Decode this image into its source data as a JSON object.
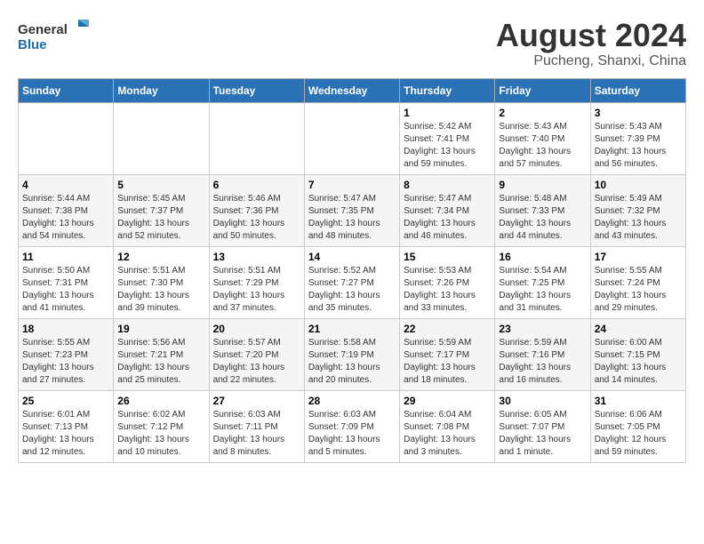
{
  "header": {
    "logo_general": "General",
    "logo_blue": "Blue",
    "month_title": "August 2024",
    "location": "Pucheng, Shanxi, China"
  },
  "days_of_week": [
    "Sunday",
    "Monday",
    "Tuesday",
    "Wednesday",
    "Thursday",
    "Friday",
    "Saturday"
  ],
  "weeks": [
    [
      {
        "day": "",
        "content": ""
      },
      {
        "day": "",
        "content": ""
      },
      {
        "day": "",
        "content": ""
      },
      {
        "day": "",
        "content": ""
      },
      {
        "day": "1",
        "content": "Sunrise: 5:42 AM\nSunset: 7:41 PM\nDaylight: 13 hours\nand 59 minutes."
      },
      {
        "day": "2",
        "content": "Sunrise: 5:43 AM\nSunset: 7:40 PM\nDaylight: 13 hours\nand 57 minutes."
      },
      {
        "day": "3",
        "content": "Sunrise: 5:43 AM\nSunset: 7:39 PM\nDaylight: 13 hours\nand 56 minutes."
      }
    ],
    [
      {
        "day": "4",
        "content": "Sunrise: 5:44 AM\nSunset: 7:38 PM\nDaylight: 13 hours\nand 54 minutes."
      },
      {
        "day": "5",
        "content": "Sunrise: 5:45 AM\nSunset: 7:37 PM\nDaylight: 13 hours\nand 52 minutes."
      },
      {
        "day": "6",
        "content": "Sunrise: 5:46 AM\nSunset: 7:36 PM\nDaylight: 13 hours\nand 50 minutes."
      },
      {
        "day": "7",
        "content": "Sunrise: 5:47 AM\nSunset: 7:35 PM\nDaylight: 13 hours\nand 48 minutes."
      },
      {
        "day": "8",
        "content": "Sunrise: 5:47 AM\nSunset: 7:34 PM\nDaylight: 13 hours\nand 46 minutes."
      },
      {
        "day": "9",
        "content": "Sunrise: 5:48 AM\nSunset: 7:33 PM\nDaylight: 13 hours\nand 44 minutes."
      },
      {
        "day": "10",
        "content": "Sunrise: 5:49 AM\nSunset: 7:32 PM\nDaylight: 13 hours\nand 43 minutes."
      }
    ],
    [
      {
        "day": "11",
        "content": "Sunrise: 5:50 AM\nSunset: 7:31 PM\nDaylight: 13 hours\nand 41 minutes."
      },
      {
        "day": "12",
        "content": "Sunrise: 5:51 AM\nSunset: 7:30 PM\nDaylight: 13 hours\nand 39 minutes."
      },
      {
        "day": "13",
        "content": "Sunrise: 5:51 AM\nSunset: 7:29 PM\nDaylight: 13 hours\nand 37 minutes."
      },
      {
        "day": "14",
        "content": "Sunrise: 5:52 AM\nSunset: 7:27 PM\nDaylight: 13 hours\nand 35 minutes."
      },
      {
        "day": "15",
        "content": "Sunrise: 5:53 AM\nSunset: 7:26 PM\nDaylight: 13 hours\nand 33 minutes."
      },
      {
        "day": "16",
        "content": "Sunrise: 5:54 AM\nSunset: 7:25 PM\nDaylight: 13 hours\nand 31 minutes."
      },
      {
        "day": "17",
        "content": "Sunrise: 5:55 AM\nSunset: 7:24 PM\nDaylight: 13 hours\nand 29 minutes."
      }
    ],
    [
      {
        "day": "18",
        "content": "Sunrise: 5:55 AM\nSunset: 7:23 PM\nDaylight: 13 hours\nand 27 minutes."
      },
      {
        "day": "19",
        "content": "Sunrise: 5:56 AM\nSunset: 7:21 PM\nDaylight: 13 hours\nand 25 minutes."
      },
      {
        "day": "20",
        "content": "Sunrise: 5:57 AM\nSunset: 7:20 PM\nDaylight: 13 hours\nand 22 minutes."
      },
      {
        "day": "21",
        "content": "Sunrise: 5:58 AM\nSunset: 7:19 PM\nDaylight: 13 hours\nand 20 minutes."
      },
      {
        "day": "22",
        "content": "Sunrise: 5:59 AM\nSunset: 7:17 PM\nDaylight: 13 hours\nand 18 minutes."
      },
      {
        "day": "23",
        "content": "Sunrise: 5:59 AM\nSunset: 7:16 PM\nDaylight: 13 hours\nand 16 minutes."
      },
      {
        "day": "24",
        "content": "Sunrise: 6:00 AM\nSunset: 7:15 PM\nDaylight: 13 hours\nand 14 minutes."
      }
    ],
    [
      {
        "day": "25",
        "content": "Sunrise: 6:01 AM\nSunset: 7:13 PM\nDaylight: 13 hours\nand 12 minutes."
      },
      {
        "day": "26",
        "content": "Sunrise: 6:02 AM\nSunset: 7:12 PM\nDaylight: 13 hours\nand 10 minutes."
      },
      {
        "day": "27",
        "content": "Sunrise: 6:03 AM\nSunset: 7:11 PM\nDaylight: 13 hours\nand 8 minutes."
      },
      {
        "day": "28",
        "content": "Sunrise: 6:03 AM\nSunset: 7:09 PM\nDaylight: 13 hours\nand 5 minutes."
      },
      {
        "day": "29",
        "content": "Sunrise: 6:04 AM\nSunset: 7:08 PM\nDaylight: 13 hours\nand 3 minutes."
      },
      {
        "day": "30",
        "content": "Sunrise: 6:05 AM\nSunset: 7:07 PM\nDaylight: 13 hours\nand 1 minute."
      },
      {
        "day": "31",
        "content": "Sunrise: 6:06 AM\nSunset: 7:05 PM\nDaylight: 12 hours\nand 59 minutes."
      }
    ]
  ]
}
